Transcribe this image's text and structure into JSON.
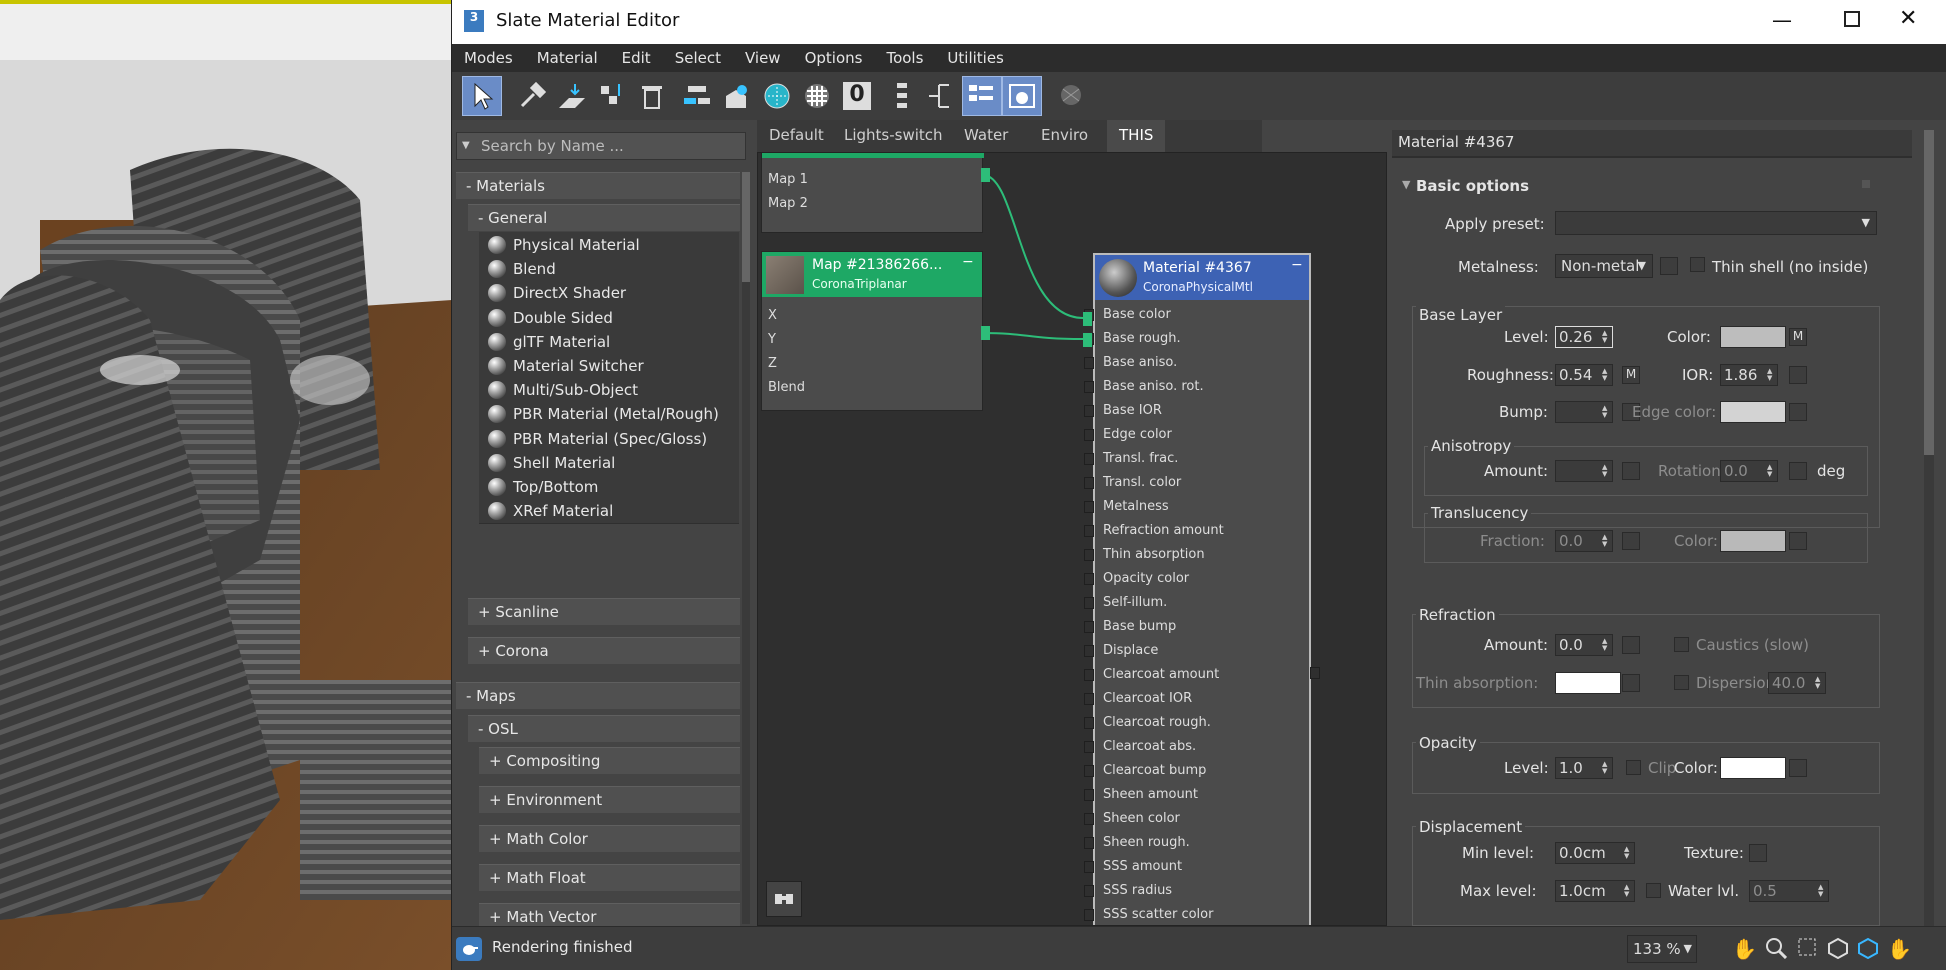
{
  "window": {
    "title": "Slate Material Editor",
    "app_badge": "3"
  },
  "menu": [
    "Modes",
    "Material",
    "Edit",
    "Select",
    "View",
    "Options",
    "Tools",
    "Utilities"
  ],
  "browser": {
    "search_placeholder": "Search by Name ...",
    "materials_label": "- Materials",
    "general_label": "- General",
    "general_items": [
      "Physical Material",
      "Blend",
      "DirectX Shader",
      "Double Sided",
      "glTF Material",
      "Material Switcher",
      "Multi/Sub-Object",
      "PBR Material (Metal/Rough)",
      "PBR Material (Spec/Gloss)",
      "Shell Material",
      "Top/Bottom",
      "XRef Material"
    ],
    "scanline_label": "+ Scanline",
    "corona_label": "+ Corona",
    "maps_label": "- Maps",
    "osl_label": "- OSL",
    "osl_items": [
      "+ Compositing",
      "+ Environment",
      "+ Math Color",
      "+ Math Float",
      "+ Math Vector"
    ]
  },
  "view_tabs": [
    "Default",
    "Lights-switch",
    "Water",
    "Enviro",
    "THIS"
  ],
  "active_tab": "THIS",
  "nodes": {
    "top_node": {
      "slots": [
        "Map 1",
        "Map 2"
      ]
    },
    "triplanar": {
      "title": "Map #21386266...",
      "subtitle": "CoronaTriplanar",
      "slots": [
        "X",
        "Y",
        "Z",
        "Blend"
      ]
    },
    "material": {
      "title": "Material #4367",
      "subtitle": "CoronaPhysicalMtl",
      "slots": [
        "Base color",
        "Base rough.",
        "Base aniso.",
        "Base aniso. rot.",
        "Base IOR",
        "Edge color",
        "Transl. frac.",
        "Transl. color",
        "Metalness",
        "Refraction amount",
        "Thin absorption",
        "Opacity color",
        "Self-illum.",
        "Base bump",
        "Displace",
        "Clearcoat amount",
        "Clearcoat IOR",
        "Clearcoat rough.",
        "Clearcoat abs.",
        "Clearcoat bump",
        "Sheen amount",
        "Sheen color",
        "Sheen rough.",
        "SSS amount",
        "SSS radius",
        "SSS scatter color"
      ]
    }
  },
  "props": {
    "header": "Material #4367",
    "rollout": "Basic options",
    "apply_preset_label": "Apply preset:",
    "metalness_label": "Metalness:",
    "metalness_value": "Non-metal",
    "thin_shell_label": "Thin shell (no inside)",
    "base_layer": {
      "title": "Base Layer",
      "level_label": "Level:",
      "level_value": "0.26",
      "color_label": "Color:",
      "m": "M",
      "roughness_label": "Roughness:",
      "roughness_value": "0.54",
      "ior_label": "IOR:",
      "ior_value": "1.86",
      "bump_label": "Bump:",
      "edge_color_label": "Edge color:",
      "anisotropy_title": "Anisotropy",
      "amount_label": "Amount:",
      "rotation_label": "Rotation:",
      "rotation_value": "0.0",
      "deg": "deg",
      "translucency_title": "Translucency",
      "fraction_label": "Fraction:",
      "fraction_value": "0.0",
      "t_color_label": "Color:"
    },
    "refraction": {
      "title": "Refraction",
      "amount_label": "Amount:",
      "amount_value": "0.0",
      "caustics_label": "Caustics (slow)",
      "thin_abs_label": "Thin absorption:",
      "dispersion_label": "Dispersion",
      "dispersion_value": "40.0"
    },
    "opacity": {
      "title": "Opacity",
      "level_label": "Level:",
      "level_value": "1.0",
      "clip_label": "Clip",
      "color_label": "Color:"
    },
    "displacement": {
      "title": "Displacement",
      "min_label": "Min level:",
      "min_value": "0.0cm",
      "texture_label": "Texture:",
      "max_label": "Max level:",
      "max_value": "1.0cm",
      "water_label": "Water lvl.",
      "water_value": "0.5"
    }
  },
  "status": {
    "text": "Rendering finished",
    "zoom": "133 %"
  },
  "colors": {
    "accent_blue": "#3d62b4",
    "node_green": "#1ea865",
    "wire": "#2dbd79"
  }
}
